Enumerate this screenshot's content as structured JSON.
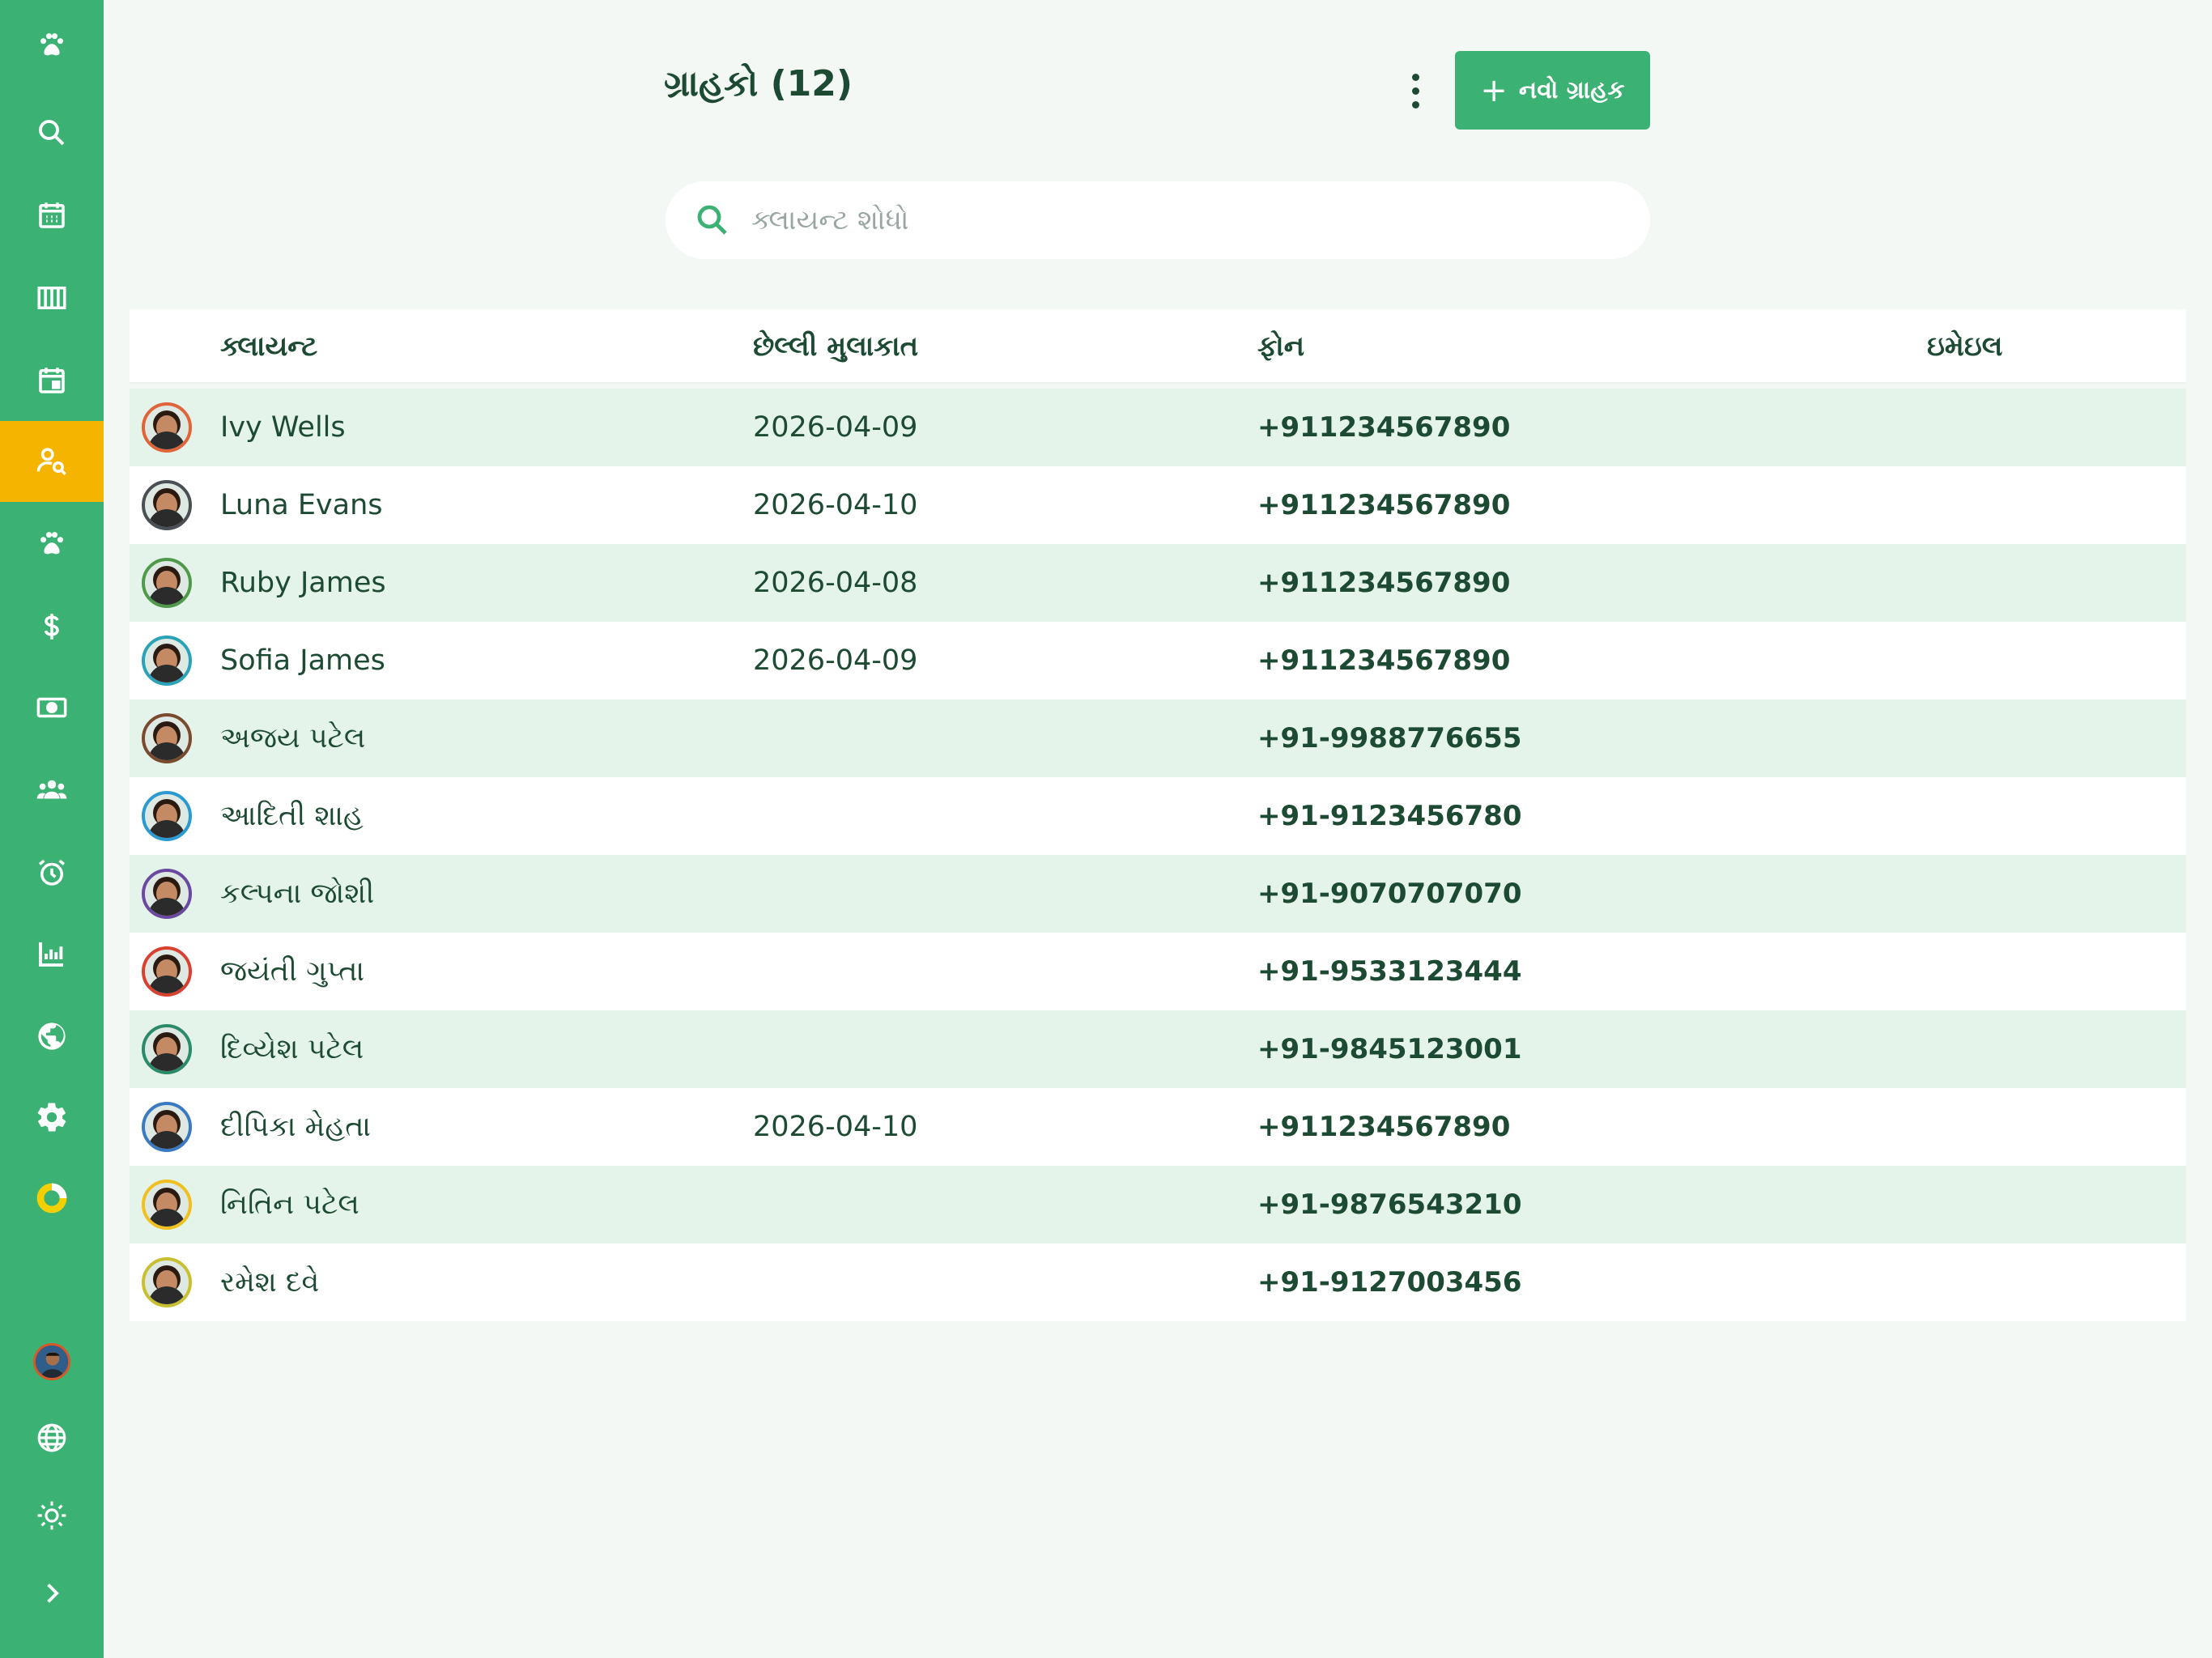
{
  "sidebar": {
    "items": [
      {
        "id": "logo",
        "icon": "paw-icon"
      },
      {
        "id": "search",
        "icon": "search-icon"
      },
      {
        "id": "calendar",
        "icon": "calendar-icon"
      },
      {
        "id": "board",
        "icon": "columns-icon"
      },
      {
        "id": "appointments",
        "icon": "event-icon"
      },
      {
        "id": "clients",
        "icon": "person-search-icon",
        "active": true
      },
      {
        "id": "pets",
        "icon": "paw-icon"
      },
      {
        "id": "billing",
        "icon": "dollar-icon"
      },
      {
        "id": "payments",
        "icon": "cash-icon"
      },
      {
        "id": "staff",
        "icon": "group-icon"
      },
      {
        "id": "reminders",
        "icon": "alarm-icon"
      },
      {
        "id": "reports",
        "icon": "bar-chart-icon"
      },
      {
        "id": "web",
        "icon": "globe-icon"
      },
      {
        "id": "settings",
        "icon": "gear-icon"
      },
      {
        "id": "status",
        "icon": "donut-icon"
      }
    ],
    "bottom": [
      {
        "id": "profile",
        "icon": "avatar"
      },
      {
        "id": "language",
        "icon": "language-icon"
      },
      {
        "id": "theme",
        "icon": "sun-icon"
      },
      {
        "id": "expand",
        "icon": "chevron-right-icon"
      }
    ]
  },
  "header": {
    "title": "ગ્રાહકો (12)",
    "new_button_label": "નવો ગ્રાહક"
  },
  "search": {
    "placeholder": "ક્લાયન્ટ શોધો",
    "value": ""
  },
  "table": {
    "columns": [
      "ક્લાયન્ટ",
      "છેલ્લી મુલાકાત",
      "ફોન",
      "ઇમેઇલ"
    ],
    "rows": [
      {
        "name": "Ivy Wells",
        "last_visit": "2026-04-09",
        "phone": "+911234567890",
        "email": "",
        "avatar_color": "#e0643a"
      },
      {
        "name": "Luna Evans",
        "last_visit": "2026-04-10",
        "phone": "+911234567890",
        "email": "",
        "avatar_color": "#4a4f55"
      },
      {
        "name": "Ruby James",
        "last_visit": "2026-04-08",
        "phone": "+911234567890",
        "email": "",
        "avatar_color": "#4f9a4a"
      },
      {
        "name": "Sofia James",
        "last_visit": "2026-04-09",
        "phone": "+911234567890",
        "email": "",
        "avatar_color": "#2aa3b8"
      },
      {
        "name": "અજય પટેલ",
        "last_visit": "",
        "phone": "+91-9988776655",
        "email": "",
        "avatar_color": "#7a4a2e"
      },
      {
        "name": "આદિતી શાહ",
        "last_visit": "",
        "phone": "+91-9123456780",
        "email": "",
        "avatar_color": "#2a9ad0"
      },
      {
        "name": "કલ્પના જોશી",
        "last_visit": "",
        "phone": "+91-9070707070",
        "email": "",
        "avatar_color": "#6a4aa0"
      },
      {
        "name": "જયંતી ગુપ્તા",
        "last_visit": "",
        "phone": "+91-9533123444",
        "email": "",
        "avatar_color": "#d84030"
      },
      {
        "name": "દિવ્યેશ પટેલ",
        "last_visit": "",
        "phone": "+91-9845123001",
        "email": "",
        "avatar_color": "#2a8a6a"
      },
      {
        "name": "દીપિકા મેહતા",
        "last_visit": "2026-04-10",
        "phone": "+911234567890",
        "email": "",
        "avatar_color": "#3a7ac0"
      },
      {
        "name": "નિતિન પટેલ",
        "last_visit": "",
        "phone": "+91-9876543210",
        "email": "",
        "avatar_color": "#f0c020"
      },
      {
        "name": "રમેશ દવે",
        "last_visit": "",
        "phone": "+91-9127003456",
        "email": "",
        "avatar_color": "#c8c030"
      }
    ]
  },
  "colors": {
    "primary": "#3bb273",
    "active_nav": "#f5b400",
    "row_alt": "#e5f4ea",
    "text": "#1d4a32"
  }
}
